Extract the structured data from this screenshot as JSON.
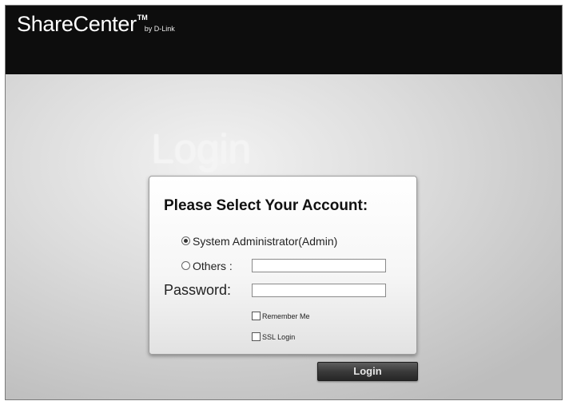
{
  "header": {
    "logo_main": "ShareCenter",
    "logo_tm": "TM",
    "logo_by": "by D-Link"
  },
  "page": {
    "heading": "Login"
  },
  "form": {
    "title": "Please Select Your Account:",
    "options": [
      {
        "label": "System Administrator(Admin)",
        "selected": true
      },
      {
        "label": "Others :",
        "selected": false
      }
    ],
    "others_value": "",
    "password_label": "Password:",
    "password_value": "",
    "remember_me_label": "Remember Me",
    "remember_me_checked": false,
    "ssl_login_label": "SSL Login",
    "ssl_login_checked": false
  },
  "login_button": {
    "label": "Login"
  },
  "colors": {
    "header_bg": "#0d0d0d",
    "button_bg": "#3a3a3a"
  }
}
